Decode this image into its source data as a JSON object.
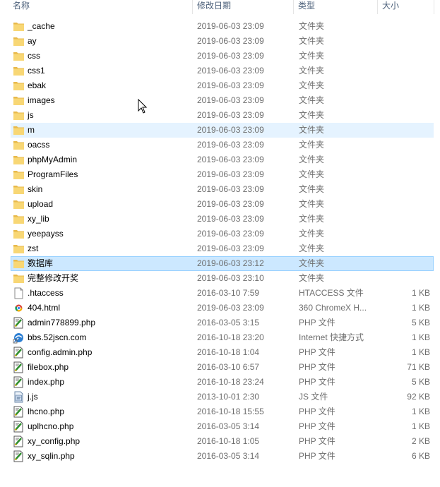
{
  "columns": {
    "name": "名称",
    "date": "修改日期",
    "type": "类型",
    "size": "大小"
  },
  "files": [
    {
      "name": "_cache",
      "date": "2019-06-03 23:09",
      "type": "文件夹",
      "size": "",
      "icon": "folder-icon",
      "state": ""
    },
    {
      "name": "ay",
      "date": "2019-06-03 23:09",
      "type": "文件夹",
      "size": "",
      "icon": "folder-icon",
      "state": ""
    },
    {
      "name": "css",
      "date": "2019-06-03 23:09",
      "type": "文件夹",
      "size": "",
      "icon": "folder-icon",
      "state": ""
    },
    {
      "name": "css1",
      "date": "2019-06-03 23:09",
      "type": "文件夹",
      "size": "",
      "icon": "folder-icon",
      "state": ""
    },
    {
      "name": "ebak",
      "date": "2019-06-03 23:09",
      "type": "文件夹",
      "size": "",
      "icon": "folder-icon",
      "state": ""
    },
    {
      "name": "images",
      "date": "2019-06-03 23:09",
      "type": "文件夹",
      "size": "",
      "icon": "folder-icon",
      "state": ""
    },
    {
      "name": "js",
      "date": "2019-06-03 23:09",
      "type": "文件夹",
      "size": "",
      "icon": "folder-icon",
      "state": ""
    },
    {
      "name": "m",
      "date": "2019-06-03 23:09",
      "type": "文件夹",
      "size": "",
      "icon": "folder-icon",
      "state": "hover"
    },
    {
      "name": "oacss",
      "date": "2019-06-03 23:09",
      "type": "文件夹",
      "size": "",
      "icon": "folder-icon",
      "state": ""
    },
    {
      "name": "phpMyAdmin",
      "date": "2019-06-03 23:09",
      "type": "文件夹",
      "size": "",
      "icon": "folder-icon",
      "state": ""
    },
    {
      "name": "ProgramFiles",
      "date": "2019-06-03 23:09",
      "type": "文件夹",
      "size": "",
      "icon": "folder-icon",
      "state": ""
    },
    {
      "name": "skin",
      "date": "2019-06-03 23:09",
      "type": "文件夹",
      "size": "",
      "icon": "folder-icon",
      "state": ""
    },
    {
      "name": "upload",
      "date": "2019-06-03 23:09",
      "type": "文件夹",
      "size": "",
      "icon": "folder-icon",
      "state": ""
    },
    {
      "name": "xy_lib",
      "date": "2019-06-03 23:09",
      "type": "文件夹",
      "size": "",
      "icon": "folder-icon",
      "state": ""
    },
    {
      "name": "yeepayss",
      "date": "2019-06-03 23:09",
      "type": "文件夹",
      "size": "",
      "icon": "folder-icon",
      "state": ""
    },
    {
      "name": "zst",
      "date": "2019-06-03 23:09",
      "type": "文件夹",
      "size": "",
      "icon": "folder-icon",
      "state": ""
    },
    {
      "name": "数据库",
      "date": "2019-06-03 23:12",
      "type": "文件夹",
      "size": "",
      "icon": "folder-icon",
      "state": "selected"
    },
    {
      "name": "完整修改开奖",
      "date": "2019-06-03 23:10",
      "type": "文件夹",
      "size": "",
      "icon": "folder-icon",
      "state": ""
    },
    {
      "name": ".htaccess",
      "date": "2016-03-10 7:59",
      "type": "HTACCESS 文件",
      "size": "1 KB",
      "icon": "blank-file-icon",
      "state": ""
    },
    {
      "name": "404.html",
      "date": "2019-06-03 23:09",
      "type": "360 ChromeX H...",
      "size": "1 KB",
      "icon": "chrome-html-icon",
      "state": ""
    },
    {
      "name": "admin778899.php",
      "date": "2016-03-05 3:15",
      "type": "PHP 文件",
      "size": "5 KB",
      "icon": "php-file-icon",
      "state": ""
    },
    {
      "name": "bbs.52jscn.com",
      "date": "2016-10-18 23:20",
      "type": "Internet 快捷方式",
      "size": "1 KB",
      "icon": "internet-shortcut-icon",
      "state": ""
    },
    {
      "name": "config.admin.php",
      "date": "2016-10-18 1:04",
      "type": "PHP 文件",
      "size": "1 KB",
      "icon": "php-file-icon",
      "state": ""
    },
    {
      "name": "filebox.php",
      "date": "2016-03-10 6:57",
      "type": "PHP 文件",
      "size": "71 KB",
      "icon": "php-file-icon",
      "state": ""
    },
    {
      "name": "index.php",
      "date": "2016-10-18 23:24",
      "type": "PHP 文件",
      "size": "5 KB",
      "icon": "php-file-icon",
      "state": ""
    },
    {
      "name": "j.js",
      "date": "2013-10-01 2:30",
      "type": "JS 文件",
      "size": "92 KB",
      "icon": "js-file-icon",
      "state": ""
    },
    {
      "name": "lhcno.php",
      "date": "2016-10-18 15:55",
      "type": "PHP 文件",
      "size": "1 KB",
      "icon": "php-file-icon",
      "state": ""
    },
    {
      "name": "uplhcno.php",
      "date": "2016-03-05 3:14",
      "type": "PHP 文件",
      "size": "1 KB",
      "icon": "php-file-icon",
      "state": ""
    },
    {
      "name": "xy_config.php",
      "date": "2016-10-18 1:05",
      "type": "PHP 文件",
      "size": "2 KB",
      "icon": "php-file-icon",
      "state": ""
    },
    {
      "name": "xy_sqlin.php",
      "date": "2016-03-05 3:14",
      "type": "PHP 文件",
      "size": "6 KB",
      "icon": "php-file-icon",
      "state": ""
    }
  ],
  "colors": {
    "header_text": "#4c607a",
    "secondary_text": "#6d6d6d",
    "hover_bg": "#e5f3ff",
    "selected_bg": "#cce8ff",
    "selected_border": "#99d1ff",
    "folder_yellow": "#f8d775"
  }
}
